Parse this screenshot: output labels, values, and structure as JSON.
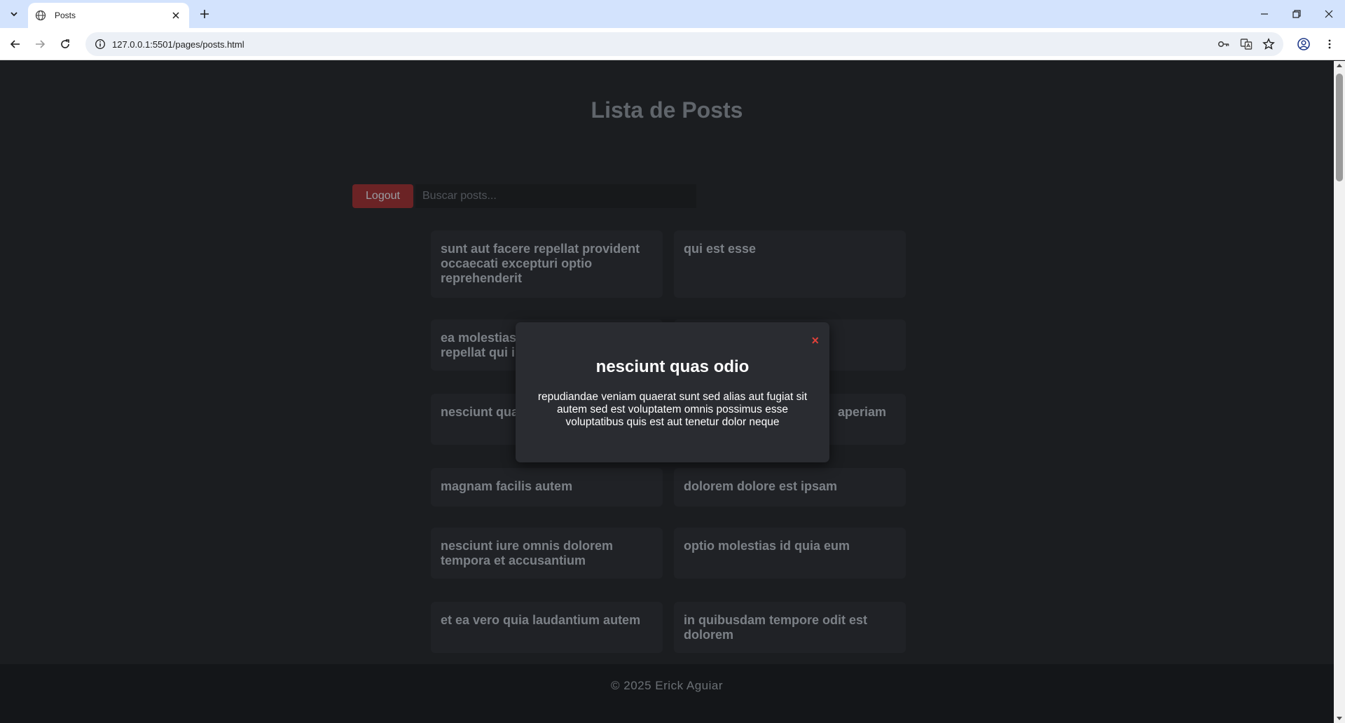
{
  "browser": {
    "tab_title": "Posts",
    "url": "127.0.0.1:5501/pages/posts.html"
  },
  "page": {
    "title": "Lista de Posts",
    "logout_label": "Logout",
    "search_placeholder": "Buscar posts...",
    "posts": [
      "sunt aut facere repellat provident occaecati excepturi optio reprehenderit",
      "qui est esse",
      "ea molestias",
      "repellat qui ip",
      "nesciunt qua",
      "aperiam",
      "magnam facilis autem",
      "dolorem dolore est ipsam",
      "nesciunt iure omnis dolorem tempora et accusantium",
      "optio molestias id quia eum",
      "et ea vero quia laudantium autem",
      "in quibusdam tempore odit est dolorem"
    ],
    "footer": "© 2025 Erick Aguiar"
  },
  "modal": {
    "close_symbol": "×",
    "title": "nesciunt quas odio",
    "body": "repudiandae veniam quaerat sunt sed alias aut fugiat sit autem sed est voluptatem omnis possimus esse voluptatibus quis est aut tenetur dolor neque"
  },
  "colors": {
    "accent_logout": "#6b2325",
    "modal_close": "#e0413a",
    "background": "#1b1d20"
  }
}
